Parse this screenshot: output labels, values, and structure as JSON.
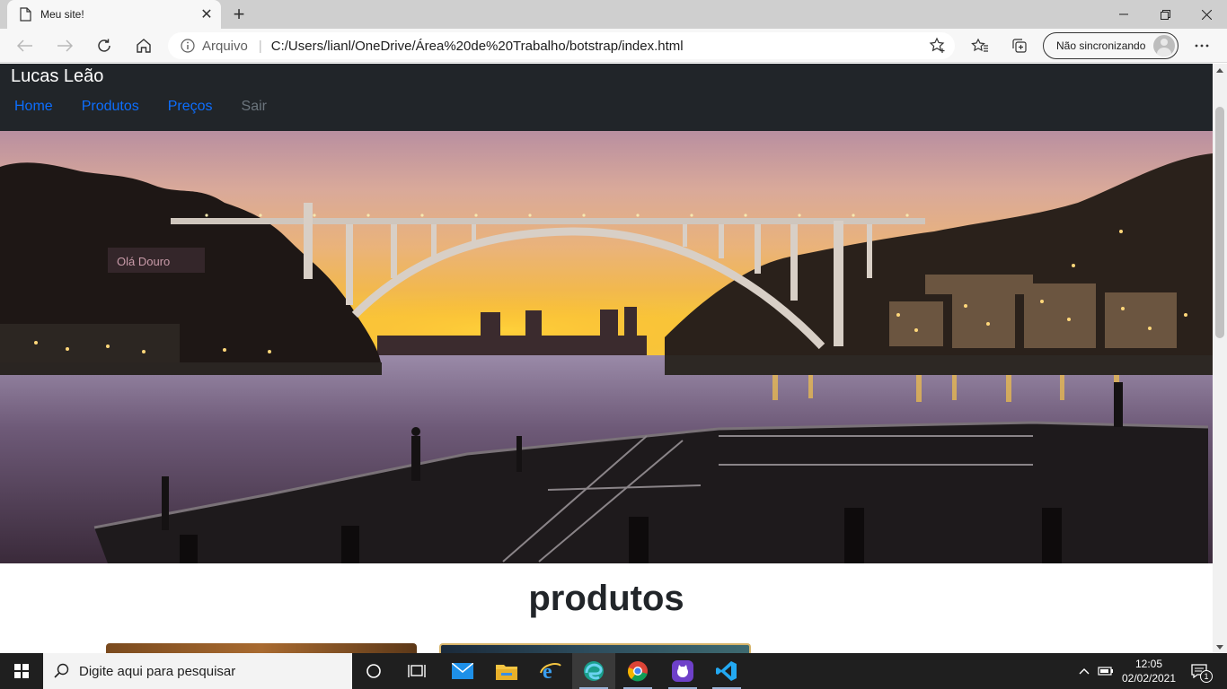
{
  "browser": {
    "tab_title": "Meu site!",
    "omnibox": {
      "scheme_label": "Arquivo",
      "url": "C:/Users/lianl/OneDrive/Área%20de%20Trabalho/botstrap/index.html"
    },
    "sync_label": "Não sincronizando"
  },
  "site": {
    "brand": "Lucas Leão",
    "nav": [
      {
        "label": "Home"
      },
      {
        "label": "Produtos"
      },
      {
        "label": "Preços"
      },
      {
        "label": "Sair"
      }
    ],
    "hero_sign_text": "Olá Douro",
    "section_title": "produtos"
  },
  "taskbar": {
    "search_placeholder": "Digite aqui para pesquisar",
    "clock": {
      "time": "12:05",
      "date": "02/02/2021"
    },
    "notification_count": "1"
  },
  "colors": {
    "navbar_bg": "#212529",
    "link": "#0d6efd",
    "link_disabled": "#6c757d",
    "taskbar_bg": "#1f1f1f"
  }
}
